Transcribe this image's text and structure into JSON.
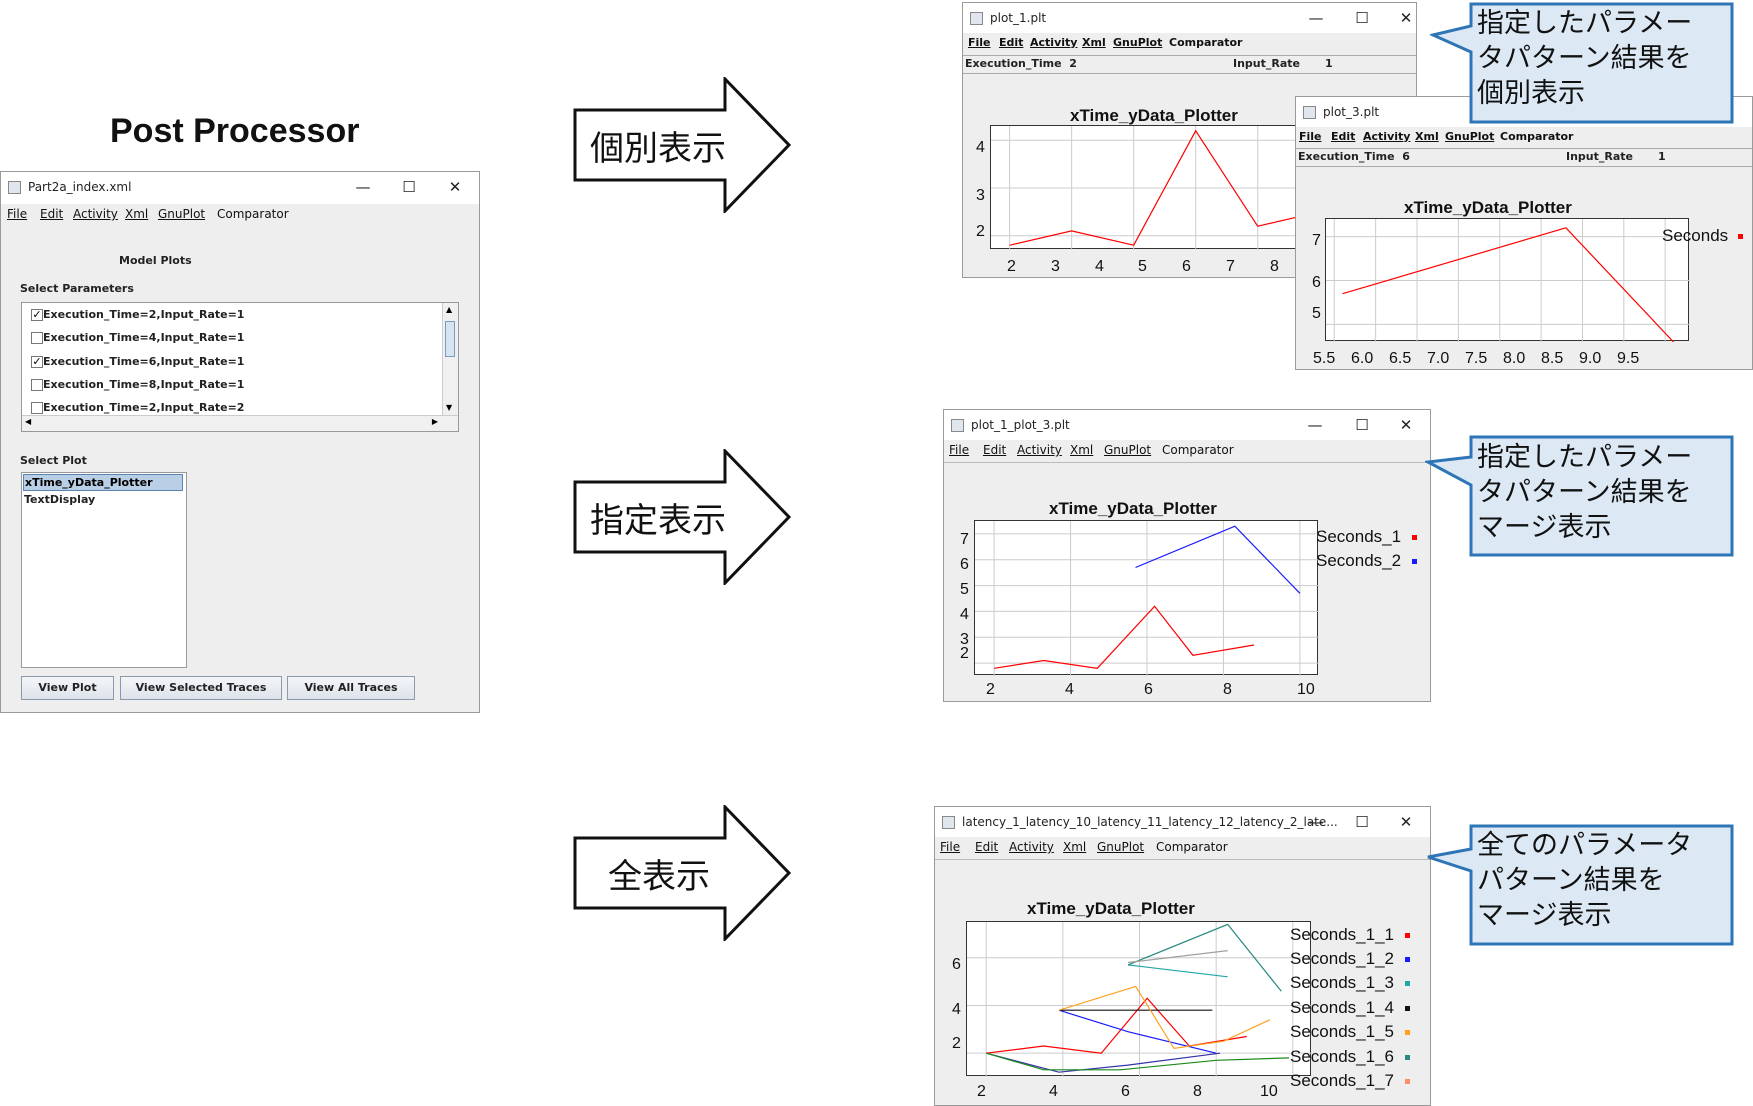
{
  "heading": "Post Processor",
  "main_window": {
    "title": "Part2a_index.xml",
    "menu": [
      "File",
      "Edit",
      "Activity",
      "Xml",
      "GnuPlot",
      "Comparator"
    ],
    "section_title": "Model Plots",
    "select_params_label": "Select Parameters",
    "params": [
      {
        "label": "Execution_Time=2,Input_Rate=1",
        "checked": true
      },
      {
        "label": "Execution_Time=4,Input_Rate=1",
        "checked": false
      },
      {
        "label": "Execution_Time=6,Input_Rate=1",
        "checked": true
      },
      {
        "label": "Execution_Time=8,Input_Rate=1",
        "checked": false
      },
      {
        "label": "Execution_Time=2,Input_Rate=2",
        "checked": false
      }
    ],
    "select_plot_label": "Select Plot",
    "plots": [
      "xTime_yData_Plotter",
      "TextDisplay"
    ],
    "buttons": {
      "view_plot": "View Plot",
      "view_selected": "View Selected Traces",
      "view_all": "View All Traces"
    }
  },
  "arrows": {
    "individual": "個別表示",
    "specified": "指定表示",
    "all": "全表示"
  },
  "callouts": {
    "individual": [
      "指定したパラメー",
      "タパターン結果を",
      "個別表示"
    ],
    "specified": [
      "指定したパラメー",
      "タパターン結果を",
      "マージ表示"
    ],
    "all": [
      "全てのパラメータ",
      "パターン結果を",
      "マージ表示"
    ]
  },
  "win_plot1": {
    "title": "plot_1.plt",
    "info_left": "Execution_Time  2",
    "info_mid": "Input_Rate",
    "info_right": "1",
    "plot_title": "xTime_yData_Plotter",
    "x_ticks": [
      "2",
      "3",
      "4",
      "5",
      "6",
      "7",
      "8"
    ],
    "y_ticks": [
      "4",
      "3",
      "2"
    ]
  },
  "win_plot3": {
    "title": "plot_3.plt",
    "info_left": "Execution_Time  6",
    "info_mid": "Input_Rate",
    "info_right": "1",
    "plot_title": "xTime_yData_Plotter",
    "x_ticks": [
      "5.5",
      "6.0",
      "6.5",
      "7.0",
      "7.5",
      "8.0",
      "8.5",
      "9.0",
      "9.5"
    ],
    "y_ticks": [
      "7",
      "6",
      "5"
    ],
    "legend": [
      "Seconds"
    ]
  },
  "win_merge": {
    "title": "plot_1_plot_3.plt",
    "plot_title": "xTime_yData_Plotter",
    "x_ticks": [
      "2",
      "4",
      "6",
      "8",
      "10"
    ],
    "y_ticks": [
      "7",
      "6",
      "5",
      "4",
      "3",
      "2"
    ],
    "legend": [
      "Seconds_1",
      "Seconds_2"
    ]
  },
  "win_all": {
    "title": "latency_1_latency_10_latency_11_latency_12_latency_2_late...",
    "plot_title": "xTime_yData_Plotter",
    "x_ticks": [
      "2",
      "4",
      "6",
      "8",
      "10"
    ],
    "y_ticks": [
      "6",
      "4",
      "2"
    ],
    "legend": [
      "Seconds_1_1",
      "Seconds_1_2",
      "Seconds_1_3",
      "Seconds_1_4",
      "Seconds_1_5",
      "Seconds_1_6",
      "Seconds_1_7"
    ]
  },
  "colors": {
    "red": "#ff0000",
    "blue": "#1a1aff",
    "teal": "#21a6a6",
    "black": "#111111",
    "orange": "#ffa01e",
    "darkteal": "#2a8a80",
    "salmon": "#ff8c69",
    "callout_fill": "#dce9f5",
    "callout_border": "#2e75b6",
    "selection": "#b8cfe5"
  },
  "chart_data": [
    {
      "type": "line",
      "title": "xTime_yData_Plotter",
      "xlim": [
        1.7,
        8.6
      ],
      "ylim": [
        1.7,
        4.3
      ],
      "series": [
        {
          "x": [
            2,
            3,
            4,
            5,
            6,
            7,
            8,
            8.5
          ],
          "y": [
            1.8,
            2.1,
            1.8,
            4.2,
            2.2,
            2.5,
            2.6,
            2.7
          ]
        }
      ]
    },
    {
      "type": "line",
      "title": "xTime_yData_Plotter",
      "xlim": [
        5.4,
        9.8
      ],
      "ylim": [
        4.6,
        7.4
      ],
      "series": [
        {
          "name": "Seconds",
          "x": [
            5.6,
            8.3,
            9.6
          ],
          "y": [
            5.7,
            7.2,
            4.6
          ]
        }
      ]
    },
    {
      "type": "line",
      "title": "xTime_yData_Plotter",
      "xlim": [
        1.5,
        10.5
      ],
      "ylim": [
        1.5,
        7.5
      ],
      "series": [
        {
          "name": "Seconds_1",
          "x": [
            2,
            3.3,
            4.7,
            6.2,
            7.2,
            8.8
          ],
          "y": [
            1.8,
            2.1,
            1.8,
            4.2,
            2.3,
            2.7
          ]
        },
        {
          "name": "Seconds_2",
          "x": [
            5.7,
            8.3,
            10
          ],
          "y": [
            5.7,
            7.3,
            4.7
          ]
        }
      ]
    },
    {
      "type": "line",
      "title": "xTime_yData_Plotter",
      "xlim": [
        1.5,
        10.5
      ],
      "ylim": [
        1,
        7.5
      ],
      "series": [
        {
          "name": "Seconds_1_1",
          "x": [
            2,
            3.5,
            5,
            6.2,
            7.3,
            8.8
          ],
          "y": [
            2,
            2.3,
            2,
            4.3,
            2.3,
            2.7
          ]
        },
        {
          "name": "Seconds_1_2",
          "x": [
            3.9,
            5.7,
            8
          ],
          "y": [
            3.8,
            2.9,
            2
          ]
        },
        {
          "name": "Seconds_1_3",
          "x": [
            5.7,
            8.3
          ],
          "y": [
            5.7,
            5.2
          ]
        },
        {
          "name": "Seconds_1_4",
          "x": [
            3.9,
            7.9
          ],
          "y": [
            3.8,
            3.8
          ]
        },
        {
          "name": "Seconds_1_5",
          "x": [
            3.9,
            5.9,
            6.9,
            8.2,
            9.4
          ],
          "y": [
            3.8,
            4.8,
            2.2,
            2.5,
            3.4
          ]
        },
        {
          "name": "Seconds_1_6",
          "x": [
            5.7,
            8.3,
            9.7
          ],
          "y": [
            5.7,
            7.4,
            4.6
          ]
        },
        {
          "name": "Seconds_1_7",
          "x": [
            5.7,
            8.3
          ],
          "y": [
            5.8,
            6.3
          ]
        },
        {
          "name": "",
          "x": [
            2,
            3.9,
            5.7,
            8.1
          ],
          "y": [
            2,
            1.2,
            1.5,
            2
          ]
        },
        {
          "name": "",
          "x": [
            2,
            3.5,
            5.5,
            8,
            9.9
          ],
          "y": [
            2,
            1.3,
            1.3,
            1.7,
            1.8
          ]
        }
      ]
    }
  ]
}
